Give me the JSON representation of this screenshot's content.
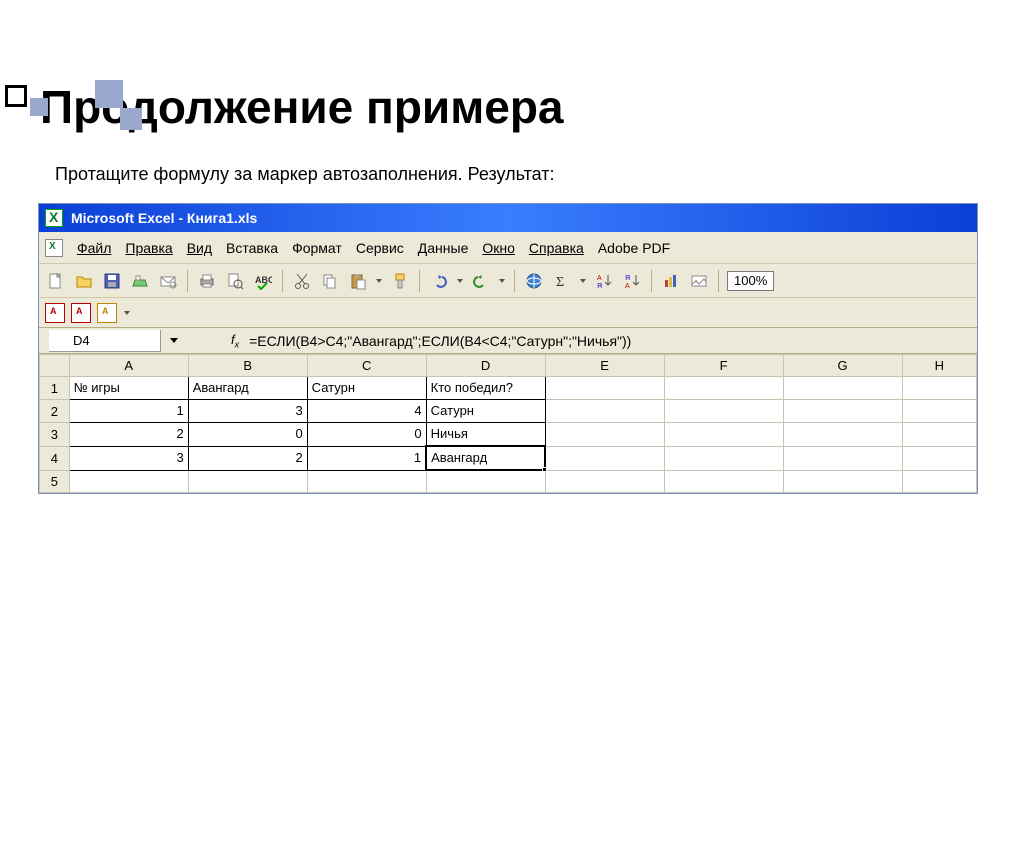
{
  "slide": {
    "title": "Продолжение примера",
    "subtitle": "Протащите формулу за маркер автозаполнения. Результат:"
  },
  "window": {
    "title": "Microsoft Excel - Книга1.xls"
  },
  "menu": {
    "file": "Файл",
    "edit": "Правка",
    "view": "Вид",
    "insert": "Вставка",
    "format": "Формат",
    "tools": "Сервис",
    "data": "Данные",
    "window": "Окно",
    "help": "Справка",
    "adobe": "Adobe PDF"
  },
  "toolbar": {
    "zoom": "100%"
  },
  "formula_bar": {
    "cell": "D4",
    "fx_label": "fx",
    "formula": "=ЕСЛИ(B4>C4;\"Авангард\";ЕСЛИ(B4<C4;\"Сатурн\";\"Ничья\"))"
  },
  "columns": [
    "A",
    "B",
    "C",
    "D",
    "E",
    "F",
    "G",
    "H"
  ],
  "rows": [
    "1",
    "2",
    "3",
    "4",
    "5"
  ],
  "table": {
    "headers": {
      "A": "№ игры",
      "B": "Авангард",
      "C": "Сатурн",
      "D": "Кто победил?"
    },
    "data": [
      {
        "A": "1",
        "B": "3",
        "C": "4",
        "D": "Сатурн"
      },
      {
        "A": "2",
        "B": "0",
        "C": "0",
        "D": "Ничья"
      },
      {
        "A": "3",
        "B": "2",
        "C": "1",
        "D": "Авангард"
      }
    ]
  }
}
